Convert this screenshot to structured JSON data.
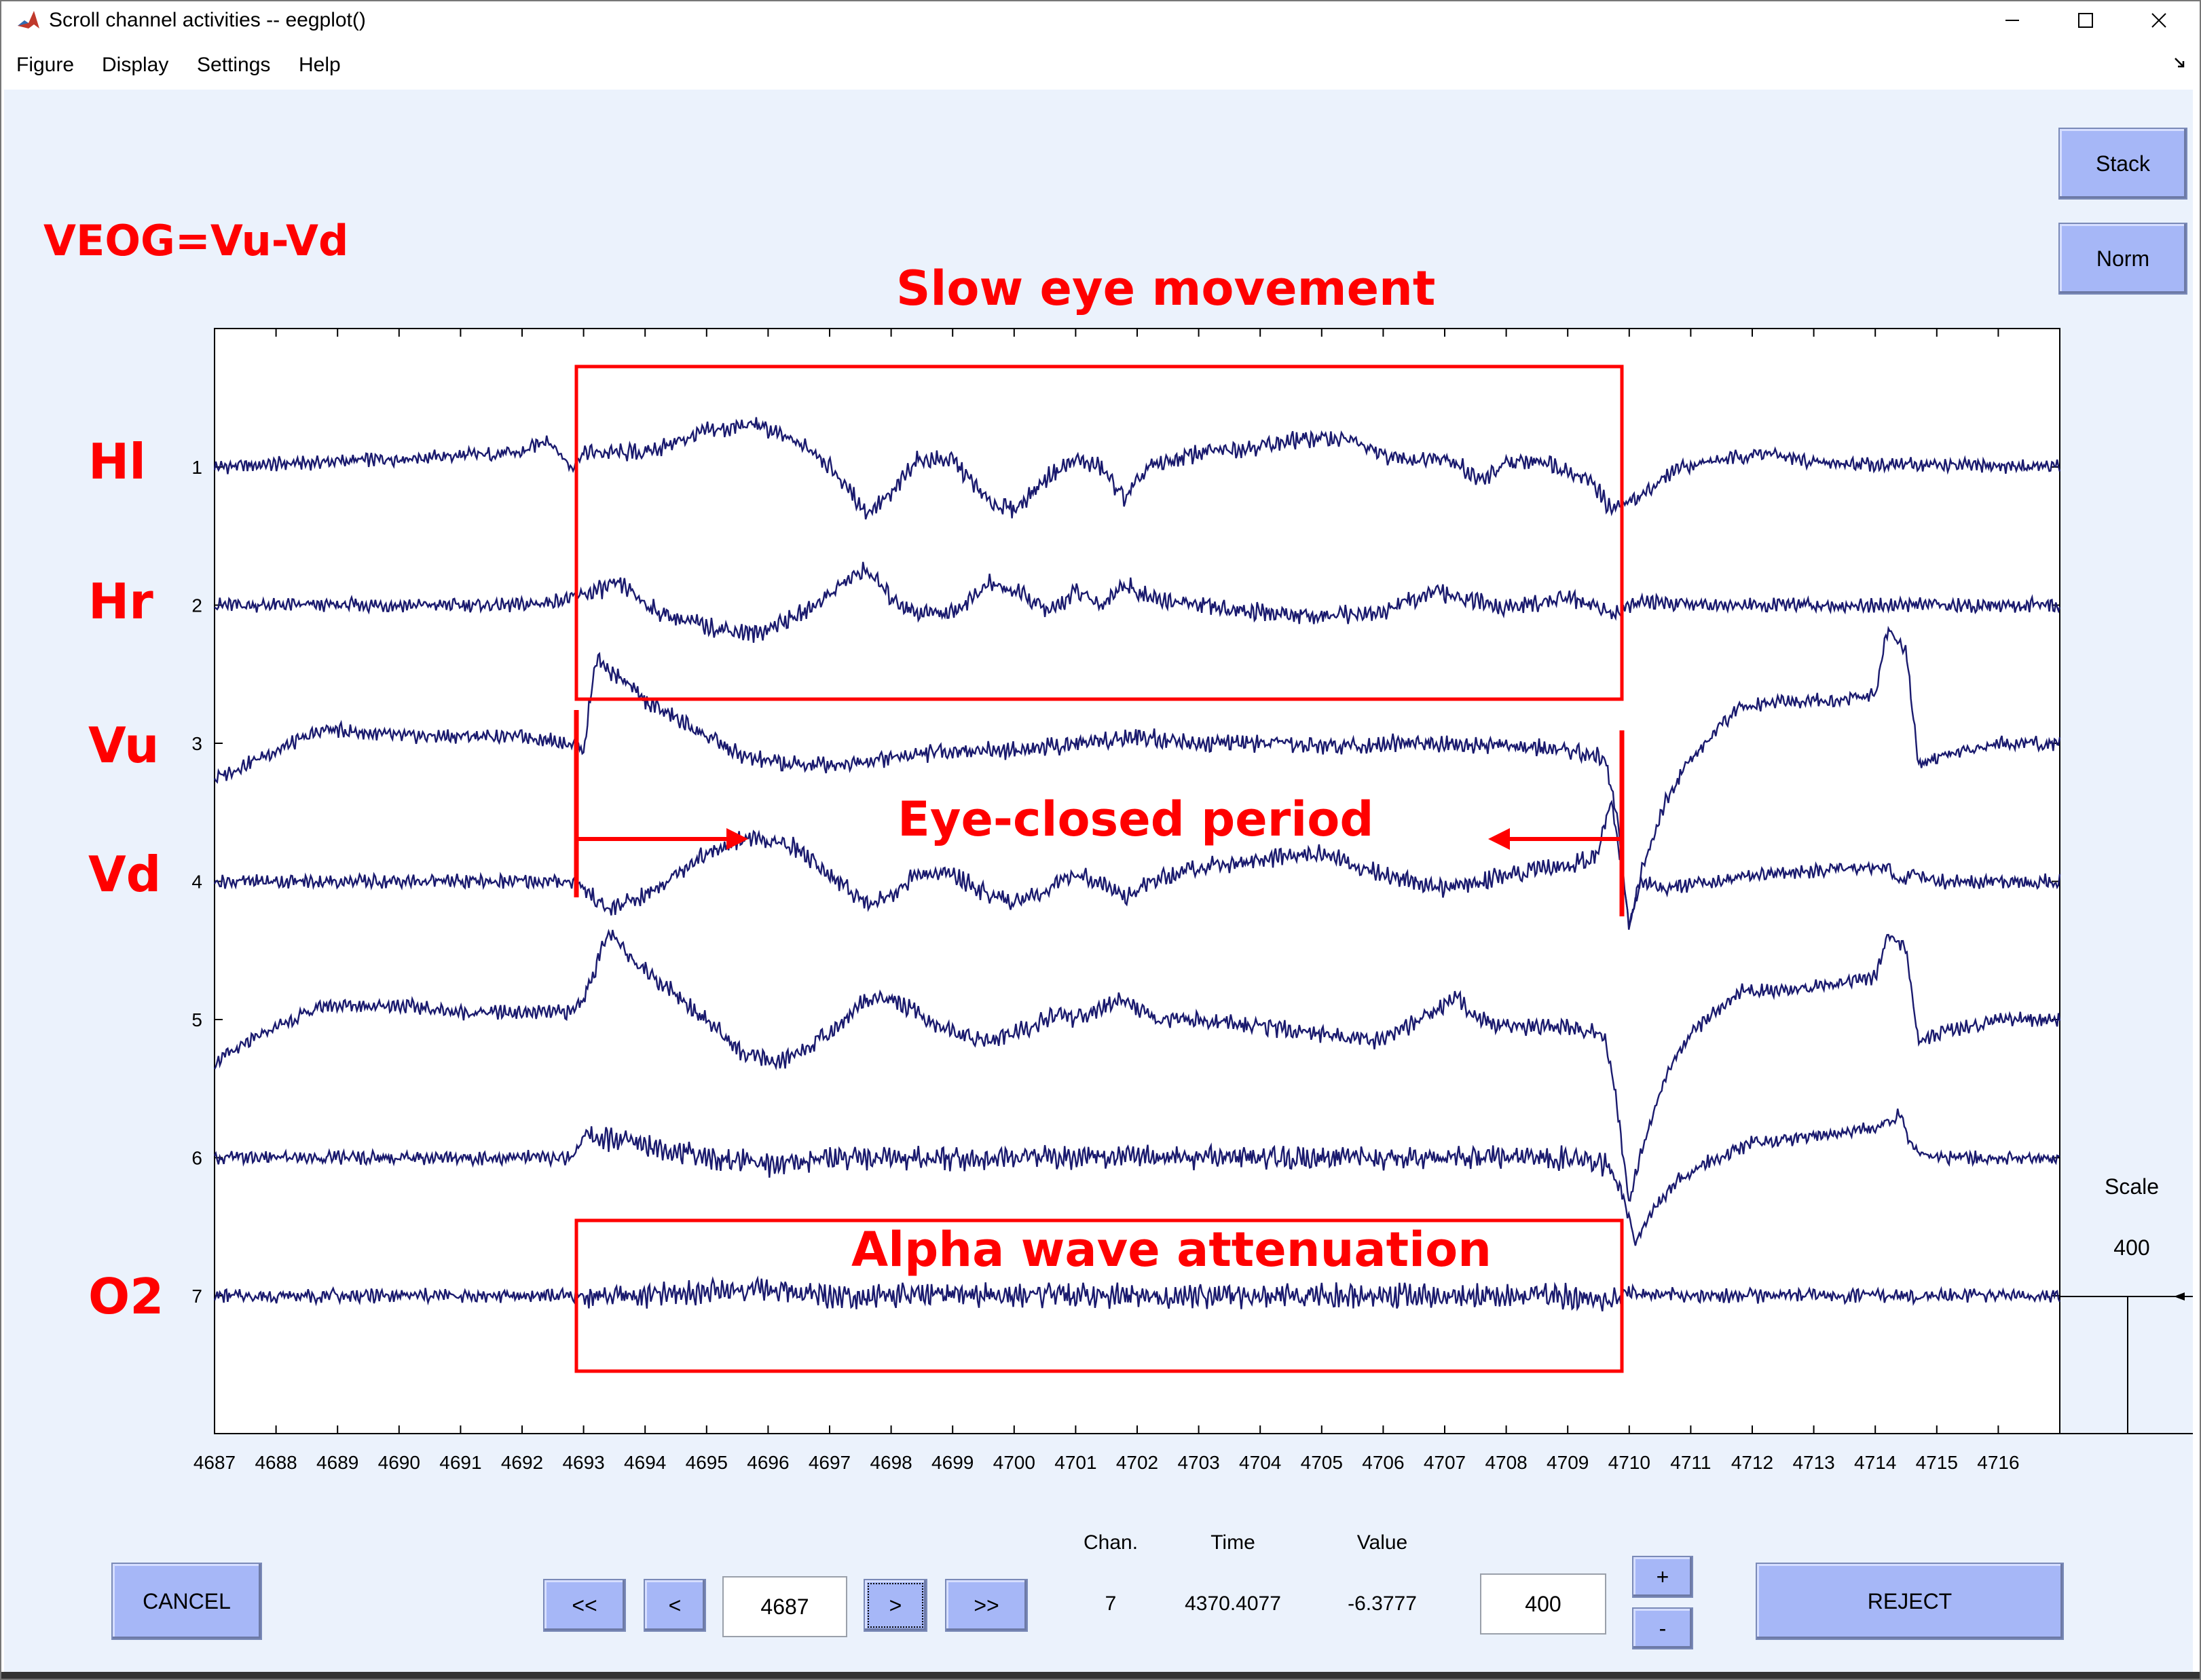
{
  "window": {
    "title": "Scroll channel activities -- eegplot()",
    "minimize_symbol": "—",
    "maximize_symbol": "☐",
    "close_symbol": "✕",
    "dock_symbol": "↘"
  },
  "menu": [
    "Figure",
    "Display",
    "Settings",
    "Help"
  ],
  "buttons": {
    "stack": "Stack",
    "norm": "Norm",
    "cancel": "CANCEL",
    "first": "<<",
    "prev": "<",
    "next": ">",
    "last": ">>",
    "plus": "+",
    "minus": "-",
    "reject": "REJECT"
  },
  "scale": {
    "label": "Scale",
    "value": "400"
  },
  "position_field": "4687",
  "spacing_field": "400",
  "readout": {
    "chan_label": "Chan.",
    "time_label": "Time",
    "value_label": "Value",
    "chan": "7",
    "time": "4370.4077",
    "value": "-6.3777"
  },
  "annotations": {
    "veog": "VEOG=Vu-Vd",
    "slow_eye": "Slow eye movement",
    "eye_closed": "Eye-closed period",
    "alpha": "Alpha wave attenuation",
    "channel_names": [
      "Hl",
      "Hr",
      "Vu",
      "Vd",
      "",
      "",
      "O2"
    ]
  },
  "colors": {
    "background": "#ebf2fc",
    "button": "#a6b7f7",
    "trace": "#1a1a6e",
    "annotation": "#ff0000"
  },
  "chart_data": {
    "type": "line",
    "xlabel": "",
    "ylabel": "",
    "x_ticks": [
      4687,
      4688,
      4689,
      4690,
      4691,
      4692,
      4693,
      4694,
      4695,
      4696,
      4697,
      4698,
      4699,
      4700,
      4701,
      4702,
      4703,
      4704,
      4705,
      4706,
      4707,
      4708,
      4709,
      4710,
      4711,
      4712,
      4713,
      4714,
      4715,
      4716
    ],
    "xlim": [
      4687,
      4717
    ],
    "y_ticks": [
      1,
      2,
      3,
      4,
      5,
      6,
      7
    ],
    "series": [
      {
        "name": "1",
        "points": [
          [
            4687,
            0
          ],
          [
            4692,
            0.1
          ],
          [
            4692.4,
            0.2
          ],
          [
            4692.8,
            0
          ],
          [
            4693,
            0.1
          ],
          [
            4694,
            0.1
          ],
          [
            4695,
            0.25
          ],
          [
            4695.8,
            0.3
          ],
          [
            4696.8,
            0.1
          ],
          [
            4697.2,
            -0.1
          ],
          [
            4697.6,
            -0.32
          ],
          [
            4698,
            -0.2
          ],
          [
            4698.4,
            0.05
          ],
          [
            4699,
            0.05
          ],
          [
            4699.6,
            -0.25
          ],
          [
            4700,
            -0.3
          ],
          [
            4700.6,
            -0.05
          ],
          [
            4701,
            0.05
          ],
          [
            4701.4,
            0
          ],
          [
            4701.8,
            -0.22
          ],
          [
            4702.2,
            0
          ],
          [
            4703,
            0.1
          ],
          [
            4704,
            0.15
          ],
          [
            4704.8,
            0.2
          ],
          [
            4705.4,
            0.2
          ],
          [
            4706,
            0.08
          ],
          [
            4706.6,
            0.05
          ],
          [
            4707,
            0.08
          ],
          [
            4707.6,
            -0.1
          ],
          [
            4708,
            0.02
          ],
          [
            4708.6,
            0.05
          ],
          [
            4709.4,
            -0.1
          ],
          [
            4709.7,
            -0.3
          ],
          [
            4710.2,
            -0.2
          ],
          [
            4710.8,
            0
          ],
          [
            4712.2,
            0.1
          ],
          [
            4713,
            0.03
          ],
          [
            4714,
            0.02
          ],
          [
            4717,
            0
          ]
        ]
      },
      {
        "name": "2",
        "points": [
          [
            4687,
            0
          ],
          [
            4692,
            0
          ],
          [
            4692.4,
            0.02
          ],
          [
            4692.8,
            0.05
          ],
          [
            4693.6,
            0.15
          ],
          [
            4694.2,
            -0.05
          ],
          [
            4695,
            -0.15
          ],
          [
            4695.8,
            -0.2
          ],
          [
            4696.6,
            -0.05
          ],
          [
            4697.2,
            0.15
          ],
          [
            4697.6,
            0.25
          ],
          [
            4698,
            0.05
          ],
          [
            4698.4,
            -0.05
          ],
          [
            4699,
            -0.05
          ],
          [
            4699.6,
            0.15
          ],
          [
            4700,
            0.1
          ],
          [
            4700.6,
            -0.05
          ],
          [
            4701,
            0.1
          ],
          [
            4701.4,
            0
          ],
          [
            4701.8,
            0.15
          ],
          [
            4702.2,
            0.05
          ],
          [
            4703,
            0
          ],
          [
            4704,
            -0.05
          ],
          [
            4705,
            -0.08
          ],
          [
            4706,
            -0.05
          ],
          [
            4706.8,
            0.1
          ],
          [
            4707.2,
            0.05
          ],
          [
            4708,
            -0.02
          ],
          [
            4709,
            0.05
          ],
          [
            4709.7,
            -0.05
          ],
          [
            4710.2,
            0.02
          ],
          [
            4712,
            0
          ],
          [
            4717,
            0
          ]
        ]
      },
      {
        "name": "3",
        "points": [
          [
            4687,
            -0.25
          ],
          [
            4688,
            -0.05
          ],
          [
            4688.8,
            0.1
          ],
          [
            4690,
            0.05
          ],
          [
            4691,
            0.05
          ],
          [
            4692,
            0.05
          ],
          [
            4692.8,
            0
          ],
          [
            4693,
            -0.05
          ],
          [
            4693.2,
            0.6
          ],
          [
            4693.6,
            0.45
          ],
          [
            4694,
            0.3
          ],
          [
            4695,
            0.05
          ],
          [
            4695.6,
            -0.1
          ],
          [
            4696.4,
            -0.15
          ],
          [
            4697,
            -0.15
          ],
          [
            4698,
            -0.1
          ],
          [
            4699,
            -0.05
          ],
          [
            4700,
            -0.05
          ],
          [
            4701,
            0
          ],
          [
            4702,
            0.05
          ],
          [
            4703,
            0
          ],
          [
            4704,
            0
          ],
          [
            4705,
            -0.02
          ],
          [
            4706,
            0
          ],
          [
            4707,
            0
          ],
          [
            4708,
            -0.02
          ],
          [
            4709,
            -0.05
          ],
          [
            4709.6,
            -0.1
          ],
          [
            4709.8,
            -0.5
          ],
          [
            4710,
            -1.3
          ],
          [
            4710.2,
            -0.9
          ],
          [
            4710.6,
            -0.4
          ],
          [
            4711,
            -0.1
          ],
          [
            4711.8,
            0.25
          ],
          [
            4712.4,
            0.3
          ],
          [
            4713.4,
            0.3
          ],
          [
            4714,
            0.35
          ],
          [
            4714.2,
            0.8
          ],
          [
            4714.5,
            0.65
          ],
          [
            4714.7,
            -0.15
          ],
          [
            4715,
            -0.1
          ],
          [
            4716,
            0
          ],
          [
            4717,
            0
          ]
        ]
      },
      {
        "name": "4",
        "points": [
          [
            4687,
            0
          ],
          [
            4692,
            0
          ],
          [
            4692.8,
            0
          ],
          [
            4693,
            -0.05
          ],
          [
            4693.4,
            -0.2
          ],
          [
            4694,
            -0.1
          ],
          [
            4694.8,
            0.15
          ],
          [
            4695.6,
            0.3
          ],
          [
            4696.4,
            0.25
          ],
          [
            4697,
            0.05
          ],
          [
            4697.6,
            -0.15
          ],
          [
            4698,
            -0.1
          ],
          [
            4698.4,
            0.05
          ],
          [
            4699,
            0.05
          ],
          [
            4699.6,
            -0.1
          ],
          [
            4700,
            -0.15
          ],
          [
            4700.6,
            -0.05
          ],
          [
            4701,
            0.05
          ],
          [
            4701.4,
            0
          ],
          [
            4701.8,
            -0.12
          ],
          [
            4702.2,
            0
          ],
          [
            4703,
            0.1
          ],
          [
            4704,
            0.15
          ],
          [
            4705,
            0.2
          ],
          [
            4705.6,
            0.1
          ],
          [
            4706,
            0.05
          ],
          [
            4707,
            -0.05
          ],
          [
            4707.6,
            0
          ],
          [
            4708,
            0.05
          ],
          [
            4709,
            0.1
          ],
          [
            4709.5,
            0.2
          ],
          [
            4709.7,
            0.6
          ],
          [
            4710,
            -0.3
          ],
          [
            4710.2,
            0
          ],
          [
            4710.6,
            -0.05
          ],
          [
            4712,
            0.05
          ],
          [
            4714.2,
            0.1
          ],
          [
            4714.4,
            0
          ],
          [
            4714.6,
            0.05
          ],
          [
            4715,
            0
          ],
          [
            4717,
            0
          ]
        ]
      },
      {
        "name": "5",
        "points": [
          [
            4687,
            -0.3
          ],
          [
            4688,
            -0.05
          ],
          [
            4688.8,
            0.1
          ],
          [
            4690,
            0.1
          ],
          [
            4691,
            0.05
          ],
          [
            4692,
            0.05
          ],
          [
            4692.8,
            0.05
          ],
          [
            4693,
            0.15
          ],
          [
            4693.4,
            0.6
          ],
          [
            4694,
            0.35
          ],
          [
            4695,
            0
          ],
          [
            4695.6,
            -0.25
          ],
          [
            4696.2,
            -0.3
          ],
          [
            4697,
            -0.1
          ],
          [
            4697.6,
            0.15
          ],
          [
            4698,
            0.15
          ],
          [
            4698.6,
            0
          ],
          [
            4699,
            -0.1
          ],
          [
            4699.6,
            -0.15
          ],
          [
            4700,
            -0.1
          ],
          [
            4700.8,
            0.05
          ],
          [
            4701,
            0
          ],
          [
            4701.8,
            0.15
          ],
          [
            4702.2,
            0
          ],
          [
            4703,
            0
          ],
          [
            4704,
            -0.05
          ],
          [
            4705,
            -0.1
          ],
          [
            4706,
            -0.15
          ],
          [
            4706.8,
            0.05
          ],
          [
            4707.2,
            0.15
          ],
          [
            4707.6,
            0
          ],
          [
            4708,
            -0.05
          ],
          [
            4709,
            -0.05
          ],
          [
            4709.6,
            -0.1
          ],
          [
            4709.8,
            -0.6
          ],
          [
            4710,
            -1.3
          ],
          [
            4710.2,
            -0.9
          ],
          [
            4710.6,
            -0.4
          ],
          [
            4711,
            -0.1
          ],
          [
            4711.8,
            0.2
          ],
          [
            4712.4,
            0.2
          ],
          [
            4713.4,
            0.25
          ],
          [
            4714,
            0.3
          ],
          [
            4714.2,
            0.6
          ],
          [
            4714.5,
            0.5
          ],
          [
            4714.7,
            -0.15
          ],
          [
            4715,
            -0.1
          ],
          [
            4716,
            0
          ],
          [
            4717,
            0
          ]
        ]
      },
      {
        "name": "6",
        "points": [
          [
            4687,
            0
          ],
          [
            4692,
            0
          ],
          [
            4692.8,
            0
          ],
          [
            4693,
            0.15
          ],
          [
            4694,
            0.1
          ],
          [
            4695,
            0
          ],
          [
            4696,
            -0.05
          ],
          [
            4697,
            0
          ],
          [
            4698,
            0
          ],
          [
            4699,
            0
          ],
          [
            4700,
            0
          ],
          [
            4701,
            0
          ],
          [
            4702,
            0.02
          ],
          [
            4703,
            0
          ],
          [
            4704,
            0
          ],
          [
            4705,
            0
          ],
          [
            4706,
            0
          ],
          [
            4707,
            0
          ],
          [
            4708,
            0
          ],
          [
            4709,
            0
          ],
          [
            4709.6,
            -0.05
          ],
          [
            4709.9,
            -0.25
          ],
          [
            4710.1,
            -0.6
          ],
          [
            4710.3,
            -0.4
          ],
          [
            4710.8,
            -0.15
          ],
          [
            4711.4,
            0
          ],
          [
            4712,
            0.1
          ],
          [
            4713,
            0.15
          ],
          [
            4714,
            0.2
          ],
          [
            4714.4,
            0.3
          ],
          [
            4714.6,
            0.05
          ],
          [
            4715,
            0
          ],
          [
            4717,
            0
          ]
        ]
      },
      {
        "name": "7",
        "points": [
          [
            4687,
            0
          ],
          [
            4692,
            0
          ],
          [
            4692.8,
            0
          ],
          [
            4693,
            0
          ],
          [
            4694,
            0
          ],
          [
            4695,
            0.03
          ],
          [
            4696,
            0.05
          ],
          [
            4697,
            0
          ],
          [
            4698,
            0
          ],
          [
            4699,
            0
          ],
          [
            4700,
            0
          ],
          [
            4701,
            0
          ],
          [
            4702,
            0
          ],
          [
            4703,
            0
          ],
          [
            4704,
            0
          ],
          [
            4705,
            0
          ],
          [
            4706,
            0
          ],
          [
            4707,
            0
          ],
          [
            4708,
            0
          ],
          [
            4709,
            0
          ],
          [
            4709.7,
            -0.05
          ],
          [
            4710,
            0.03
          ],
          [
            4711,
            0
          ],
          [
            4717,
            0
          ]
        ]
      }
    ]
  }
}
